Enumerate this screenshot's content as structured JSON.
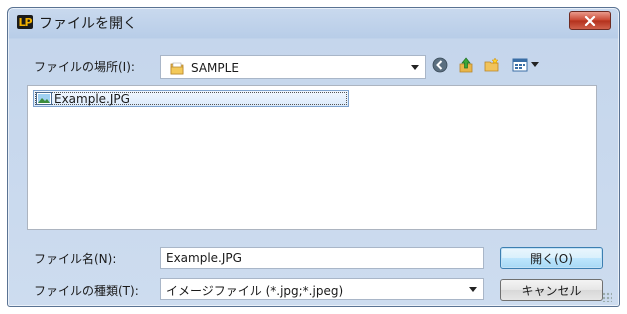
{
  "window": {
    "title": "ファイルを開く",
    "app_icon_text": "LP",
    "close_icon": "close-icon"
  },
  "location": {
    "label": "ファイルの場所(I):",
    "value": "SAMPLE",
    "icon": "folder-icon"
  },
  "toolbar": {
    "icons": [
      "back-icon",
      "up-folder-icon",
      "new-folder-icon",
      "view-menu-icon"
    ]
  },
  "file_list": {
    "items": [
      {
        "name": "Example.JPG",
        "icon": "image-file-icon",
        "selected": true
      }
    ]
  },
  "filename": {
    "label": "ファイル名(N):",
    "value": "Example.JPG"
  },
  "filetype": {
    "label": "ファイルの種類(T):",
    "value": "イメージファイル (*.jpg;*.jpeg)"
  },
  "buttons": {
    "open": "開く(O)",
    "cancel": "キャンセル"
  },
  "colors": {
    "title_gradient_top": "#c9d9ee",
    "close_red": "#c9452f",
    "selection": "#dcebfc"
  }
}
